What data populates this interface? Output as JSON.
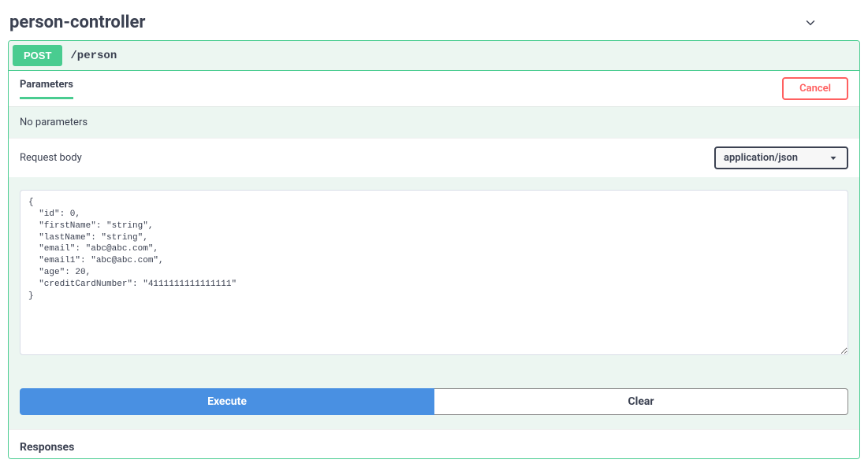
{
  "tag": {
    "title": "person-controller"
  },
  "operation": {
    "method": "POST",
    "path": "/person"
  },
  "parameters": {
    "tabLabel": "Parameters",
    "cancelLabel": "Cancel",
    "emptyMessage": "No parameters"
  },
  "requestBody": {
    "label": "Request body",
    "contentType": "application/json",
    "value": "{\n  \"id\": 0,\n  \"firstName\": \"string\",\n  \"lastName\": \"string\",\n  \"email\": \"abc@abc.com\",\n  \"email1\": \"abc@abc.com\",\n  \"age\": 20,\n  \"creditCardNumber\": \"4111111111111111\"\n}"
  },
  "actions": {
    "execute": "Execute",
    "clear": "Clear"
  },
  "responses": {
    "title": "Responses"
  }
}
